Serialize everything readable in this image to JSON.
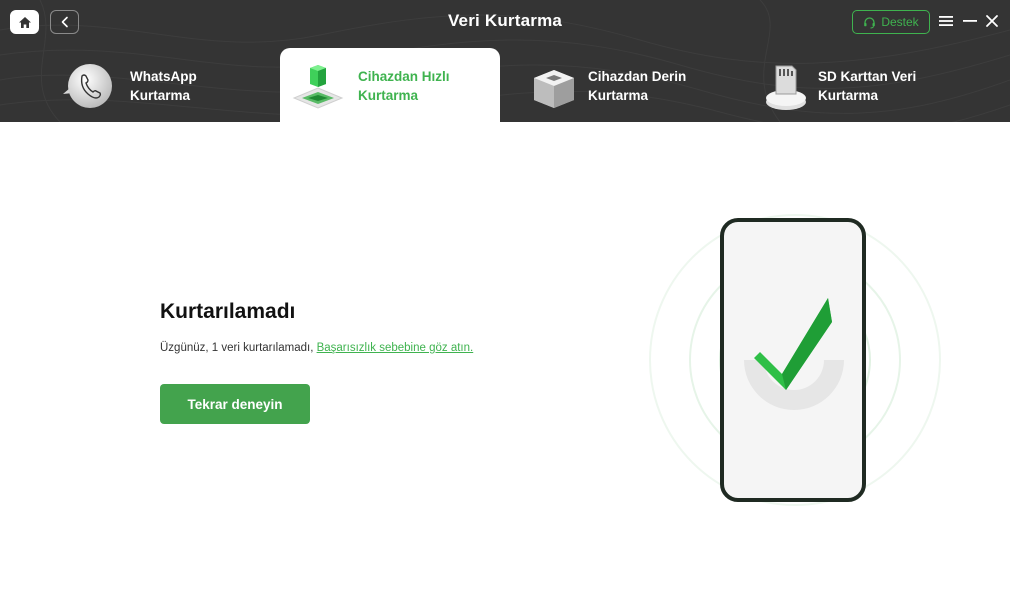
{
  "window": {
    "title": "Veri Kurtarma",
    "support_label": "Destek"
  },
  "tabs": [
    {
      "label_line1": "WhatsApp",
      "label_line2": "Kurtarma",
      "active": false
    },
    {
      "label_line1": "Cihazdan Hızlı",
      "label_line2": "Kurtarma",
      "active": true
    },
    {
      "label_line1": "Cihazdan Derin",
      "label_line2": "Kurtarma",
      "active": false
    },
    {
      "label_line1": "SD Karttan Veri",
      "label_line2": "Kurtarma",
      "active": false
    }
  ],
  "result": {
    "title": "Kurtarılamadı",
    "message": "Üzgünüz, 1 veri kurtarılamadı, ",
    "link_text": "Başarısızlık sebebine göz atın.",
    "retry_label": "Tekrar deneyin"
  },
  "icons": {
    "home": "home-icon",
    "back": "chevron-left-icon",
    "support": "headset-icon",
    "menu": "menu-icon",
    "minimize": "minimize-icon",
    "close": "close-icon",
    "illustration": "phone-check-icon"
  },
  "colors": {
    "header_bg": "#343434",
    "accent": "#3fb34f",
    "button": "#43a34d",
    "phone_frame": "#1f2a22"
  }
}
